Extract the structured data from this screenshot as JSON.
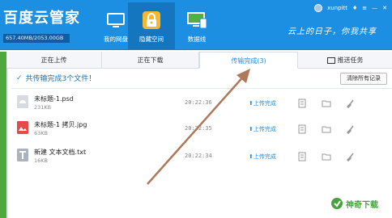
{
  "app": {
    "title": "百度云管家",
    "quota": "657.40MB/2053.00GB",
    "username": "xunpitt",
    "slogan": "云上的日子，你我共享"
  },
  "nav": [
    {
      "label": "我的网盘",
      "icon": "tv-icon"
    },
    {
      "label": "隐藏空间",
      "icon": "lock-icon",
      "active": true
    },
    {
      "label": "数据线",
      "icon": "monitor-icon"
    }
  ],
  "tabs": [
    {
      "label": "正在上传"
    },
    {
      "label": "正在下载"
    },
    {
      "label": "传输完成(3)",
      "active": true
    },
    {
      "label": "推送任务"
    }
  ],
  "summary": "共传输完成3个文件！",
  "clear_button": "清除所有记录",
  "files": [
    {
      "name": "未标题-1.psd",
      "size": "231KB",
      "time": "20:22:36",
      "status": "上传完成",
      "icon": "psd-file-icon"
    },
    {
      "name": "未标题-1 拷贝.jpg",
      "size": "63KB",
      "time": "20:22:35",
      "status": "上传完成",
      "icon": "image-file-icon"
    },
    {
      "name": "新建 文本文档.txt",
      "size": "16KB",
      "time": "20:22:34",
      "status": "上传完成",
      "icon": "text-file-icon"
    }
  ],
  "watermark": "神奇下载",
  "colors": {
    "header": "#1c8fe3",
    "active_nav": "#1576c0",
    "accent": "#1c8fe3",
    "arrow": "#b0785a",
    "green": "#4fa83b"
  }
}
